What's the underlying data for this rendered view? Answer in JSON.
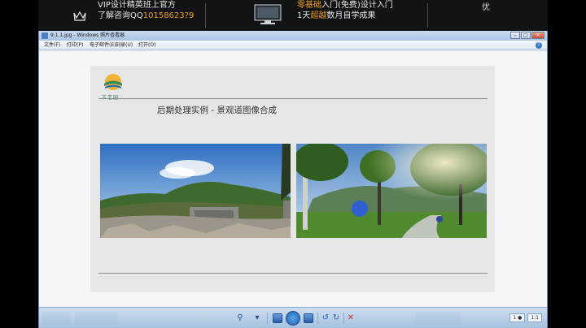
{
  "banner": {
    "left_line1_prefix": "VIP设计精英班",
    "left_line1_suffix": "上官方",
    "left_line2_prefix": "了解咨询QQ",
    "left_line2_number": "10158623?9",
    "mid_line1_orange": "零基础",
    "mid_line1_rest": "入门(免费)设计入门",
    "mid_line2_prefix": "1天",
    "mid_line2_orange": "超越",
    "mid_line2_rest": "数月自学成果",
    "right_text": "优"
  },
  "window": {
    "title": "9.1.1.jpg - Windows 照片查看器",
    "menu": [
      "文件(F)",
      "打印(P)",
      "电子邮件(E)",
      "刻录(U)",
      "打开(O)"
    ],
    "help_icon": "?"
  },
  "slide": {
    "logo_text": "古艺园",
    "title": "后期处理实例 - 景观道图像合成"
  },
  "toolbar": {
    "zoom_left": "1 ●",
    "zoom_right": "1:1"
  },
  "colors": {
    "banner_bg": "#111315",
    "accent_orange": "#f0a020",
    "frame_blue": "#6d8db8"
  }
}
